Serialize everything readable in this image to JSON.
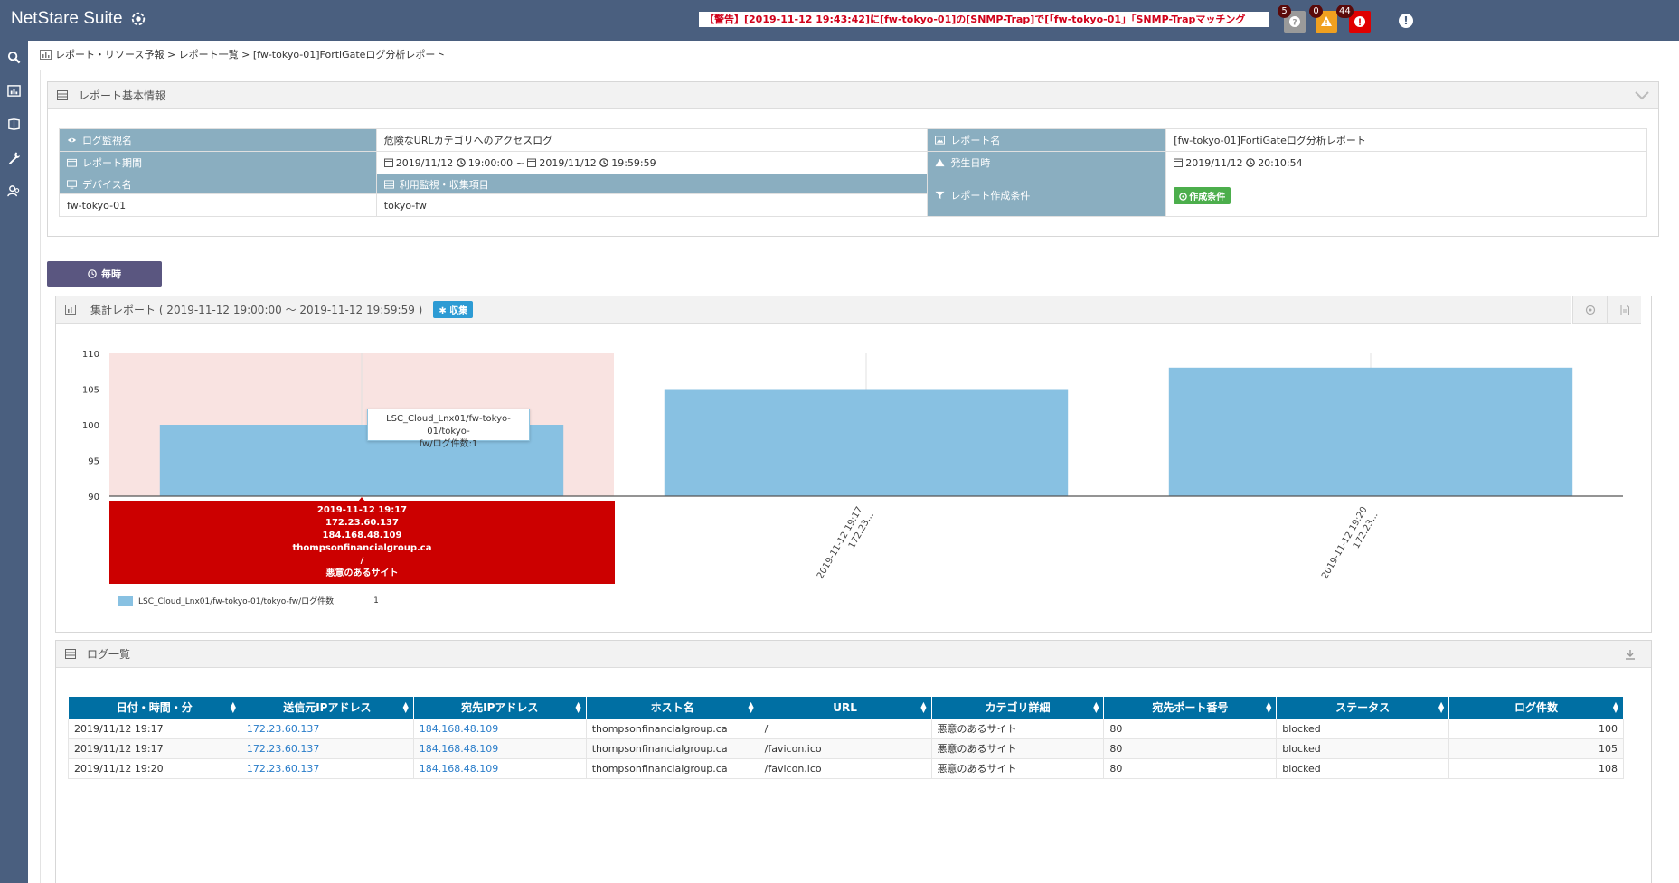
{
  "app": {
    "brand": "NetStare Suite",
    "alert_ticker": "【警告】[2019-11-12 19:43:42]に[fw-tokyo-01]の[SNMP-Trap]で[「fw-tokyo-01」「SNMP-Trapマッチング",
    "badges": {
      "info": "5",
      "warning": "0",
      "error": "44"
    },
    "info_dot": "!"
  },
  "breadcrumb": "レポート・リソース予報 > レポート一覧 > [fw-tokyo-01]FortiGateログ分析レポート",
  "basic_info": {
    "title": "レポート基本情報",
    "log_monitor_label": "ログ監視名",
    "log_monitor_value": "危険なURLカテゴリへのアクセスログ",
    "report_name_label": "レポート名",
    "report_name_value": "[fw-tokyo-01]FortiGateログ分析レポート",
    "period_label": "レポート期間",
    "period_start_date": "2019/11/12",
    "period_start_time": "19:00:00 ~",
    "period_end_date": "2019/11/12",
    "period_end_time": "19:59:59",
    "occurred_label": "発生日時",
    "occurred_date": "2019/11/12",
    "occurred_time": "20:10:54",
    "device_label": "デバイス名",
    "device_value": "fw-tokyo-01",
    "monitor_items_label": "利用監視・収集項目",
    "monitor_items_value": "tokyo-fw",
    "condition_label": "レポート作成条件",
    "condition_button": "作成条件"
  },
  "hourly_button": "毎時",
  "chart_panel": {
    "title": "集計レポート ( 2019-11-12 19:00:00 ～ 2019-11-12 19:59:59 )",
    "collect_tag": "収集",
    "tooltip_line1": "LSC_Cloud_Lnx01/fw-tokyo-01/tokyo-",
    "tooltip_line2": "fw/ログ件数:1",
    "selection_lines": [
      "2019-11-12 19:17",
      "172.23.60.137",
      "184.168.48.109",
      "thompsonfinancialgroup.ca",
      "/",
      "悪意のあるサイト"
    ],
    "legend_label": "LSC_Cloud_Lnx01/fw-tokyo-01/tokyo-fw/ログ件数",
    "legend_value": "1"
  },
  "chart_data": {
    "type": "bar",
    "categories": [
      "2019-11-12 19:17 172.23...",
      "2019-11-12 19:17 172.23...",
      "2019-11-12 19:20 172.23..."
    ],
    "x_labels_visible": [
      "",
      "2019-11-12 19:17\n172.23...",
      "2019-11-12 19:20\n172.23..."
    ],
    "series": [
      {
        "name": "LSC_Cloud_Lnx01/fw-tokyo-01/tokyo-fw/ログ件数",
        "values": [
          100,
          105,
          108
        ]
      }
    ],
    "yticks": [
      90,
      95,
      100,
      105,
      110
    ],
    "ylim": [
      90,
      110
    ],
    "highlighted_index": 0,
    "bar_color": "#88c1e2",
    "highlight_bg": "#f9e3e1"
  },
  "log_panel": {
    "title": "ログ一覧",
    "columns": [
      "日付・時間・分",
      "送信元IPアドレス",
      "宛先IPアドレス",
      "ホスト名",
      "URL",
      "カテゴリ詳細",
      "宛先ポート番号",
      "ステータス",
      "ログ件数"
    ],
    "rows": [
      [
        "2019/11/12 19:17",
        "172.23.60.137",
        "184.168.48.109",
        "thompsonfinancialgroup.ca",
        "/",
        "悪意のあるサイト",
        "80",
        "blocked",
        "100"
      ],
      [
        "2019/11/12 19:17",
        "172.23.60.137",
        "184.168.48.109",
        "thompsonfinancialgroup.ca",
        "/favicon.ico",
        "悪意のあるサイト",
        "80",
        "blocked",
        "105"
      ],
      [
        "2019/11/12 19:20",
        "172.23.60.137",
        "184.168.48.109",
        "thompsonfinancialgroup.ca",
        "/favicon.ico",
        "悪意のあるサイト",
        "80",
        "blocked",
        "108"
      ]
    ]
  }
}
